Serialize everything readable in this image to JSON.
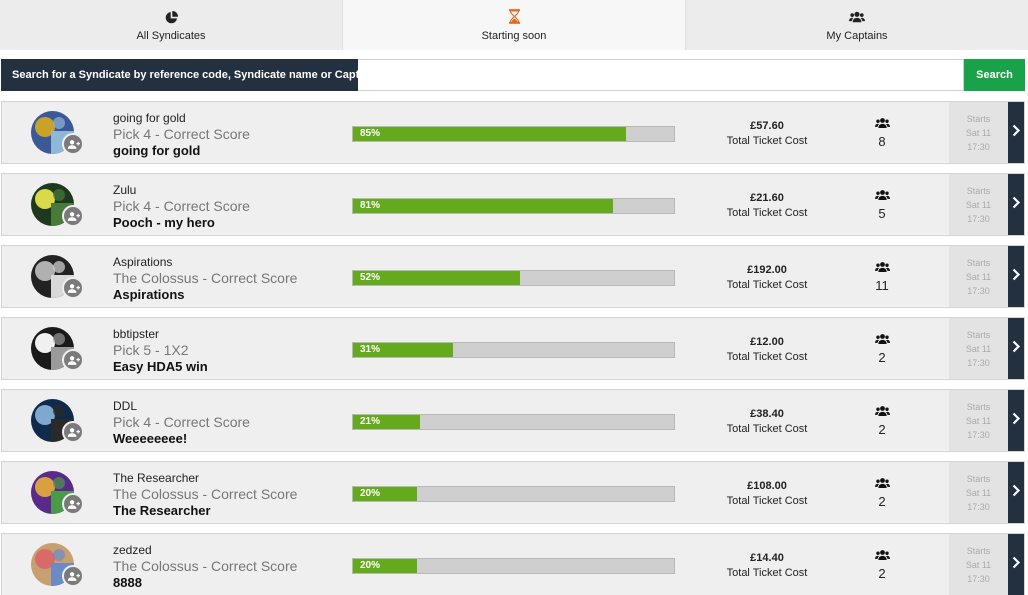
{
  "tabs": [
    {
      "label": "All Syndicates",
      "icon": "pie-chart-icon"
    },
    {
      "label": "Starting soon",
      "icon": "hourglass-icon",
      "active": true,
      "accent": "#e8671b"
    },
    {
      "label": "My Captains",
      "icon": "users-icon"
    }
  ],
  "search": {
    "label": "Search for a Syndicate by reference code, Syndicate name or Captain",
    "value": "",
    "placeholder": "",
    "button": "Search",
    "button_color": "#19a24a"
  },
  "syndicates": [
    {
      "captain": "going for gold",
      "game": "Pick 4 - Correct Score",
      "name": "going for gold",
      "progress_pct": 85,
      "progress_label": "85%",
      "cost": "£57.60",
      "cost_label": "Total Ticket Cost",
      "members": "8",
      "starts_label": "Starts",
      "start_day": "Sat 11",
      "start_time": "17:30"
    },
    {
      "captain": "Zulu",
      "game": "Pick 4 - Correct Score",
      "name": "Pooch - my hero",
      "progress_pct": 81,
      "progress_label": "81%",
      "cost": "£21.60",
      "cost_label": "Total Ticket Cost",
      "members": "5",
      "starts_label": "Starts",
      "start_day": "Sat 11",
      "start_time": "17:30"
    },
    {
      "captain": "Aspirations",
      "game": "The Colossus - Correct Score",
      "name": "Aspirations",
      "progress_pct": 52,
      "progress_label": "52%",
      "cost": "£192.00",
      "cost_label": "Total Ticket Cost",
      "members": "11",
      "starts_label": "Starts",
      "start_day": "Sat 11",
      "start_time": "17:30"
    },
    {
      "captain": "bbtipster",
      "game": "Pick 5 - 1X2",
      "name": "Easy HDA5 win",
      "progress_pct": 31,
      "progress_label": "31%",
      "cost": "£12.00",
      "cost_label": "Total Ticket Cost",
      "members": "2",
      "starts_label": "Starts",
      "start_day": "Sat 11",
      "start_time": "17:30"
    },
    {
      "captain": "DDL",
      "game": "Pick 4 - Correct Score",
      "name": "Weeeeeeee!",
      "progress_pct": 21,
      "progress_label": "21%",
      "cost": "£38.40",
      "cost_label": "Total Ticket Cost",
      "members": "2",
      "starts_label": "Starts",
      "start_day": "Sat 11",
      "start_time": "17:30"
    },
    {
      "captain": "The Researcher",
      "game": "The Colossus - Correct Score",
      "name": "The Researcher",
      "progress_pct": 20,
      "progress_label": "20%",
      "cost": "£108.00",
      "cost_label": "Total Ticket Cost",
      "members": "2",
      "starts_label": "Starts",
      "start_day": "Sat 11",
      "start_time": "17:30"
    },
    {
      "captain": "zedzed",
      "game": "The Colossus - Correct Score",
      "name": "8888",
      "progress_pct": 20,
      "progress_label": "20%",
      "cost": "£14.40",
      "cost_label": "Total Ticket Cost",
      "members": "2",
      "starts_label": "Starts",
      "start_day": "Sat 11",
      "start_time": "17:30"
    }
  ],
  "avatar_colors": [
    [
      "#3b5998",
      "#c9a227",
      "#8fb8d8"
    ],
    [
      "#1e3a1e",
      "#d9d94a",
      "#4a7a3a"
    ],
    [
      "#222222",
      "#b0b0b0",
      "#d8d8d8"
    ],
    [
      "#1a1a1a",
      "#f0f0f0",
      "#9a9a9a"
    ],
    [
      "#0f2a4a",
      "#7fa8d0",
      "#2a2a2a"
    ],
    [
      "#5a2a8a",
      "#d8a040",
      "#4a9a4a"
    ],
    [
      "#c8a070",
      "#d86a6a",
      "#6a8ac8"
    ]
  ],
  "colors": {
    "progress": "#65aa1d",
    "dark": "#22303f"
  }
}
